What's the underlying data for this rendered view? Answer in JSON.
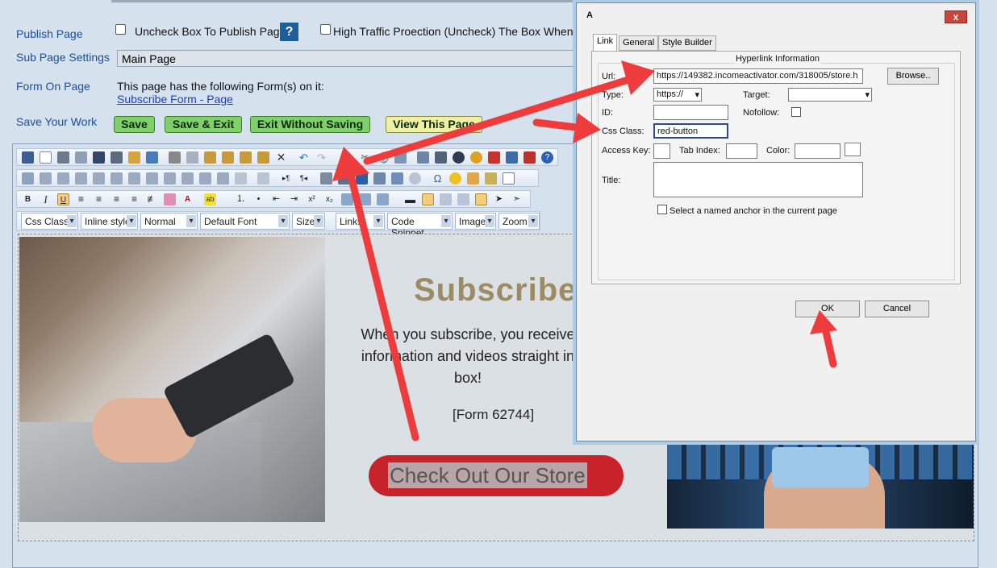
{
  "settings": {
    "publish_label": "Publish Page",
    "publish_checkbox_text": "Uncheck Box To Publish Page",
    "help_label": "?",
    "high_traffic_text": "High Traffic Proection (Uncheck) The Box When Edit",
    "subpage_label": "Sub Page Settings",
    "subpage_value": "Main Page",
    "form_label": "Form On Page",
    "form_text": "This page has the following Form(s) on it:",
    "form_link": "Subscribe Form - Page",
    "save_work_label": "Save Your Work",
    "buttons": {
      "save": "Save",
      "save_exit": "Save & Exit",
      "exit_without_saving": "Exit Without Saving",
      "view_page": "View This Page"
    }
  },
  "toolbar": {
    "dropdowns": [
      "Css Class",
      "Inline style",
      "Normal",
      "Default Font",
      "Size",
      "Links",
      "Code Snippet",
      "Images",
      "Zoom"
    ],
    "bold": "B",
    "italic": "I",
    "underline": "U"
  },
  "content": {
    "heading": "Subscribe",
    "paragraph": "When you subscribe, you receive information and videos straight in box!",
    "form_placeholder": "[Form 62744]",
    "store_button": "Check Out Our Store"
  },
  "dialog": {
    "title": "A",
    "close_label": "x",
    "tabs": [
      "Link",
      "General",
      "Style Builder"
    ],
    "group_title": "Hyperlink Information",
    "url_label": "Url:",
    "url_value": "https://149382.incomeactivator.com/318005/store.h",
    "browse_label": "Browse..",
    "type_label": "Type:",
    "type_value": "https://",
    "target_label": "Target:",
    "target_value": "",
    "id_label": "ID:",
    "nofollow_label": "Nofollow:",
    "css_class_label": "Css Class:",
    "css_class_value": "red-button",
    "access_key_label": "Access Key:",
    "tab_index_label": "Tab Index:",
    "color_label": "Color:",
    "title_label": "Title:",
    "anchor_label": "Select a named anchor in the current page",
    "ok_label": "OK",
    "cancel_label": "Cancel"
  },
  "colors": {
    "accent_red": "#ee3b3b",
    "button_green": "#7fd06a",
    "store_button": "#c8232a"
  }
}
